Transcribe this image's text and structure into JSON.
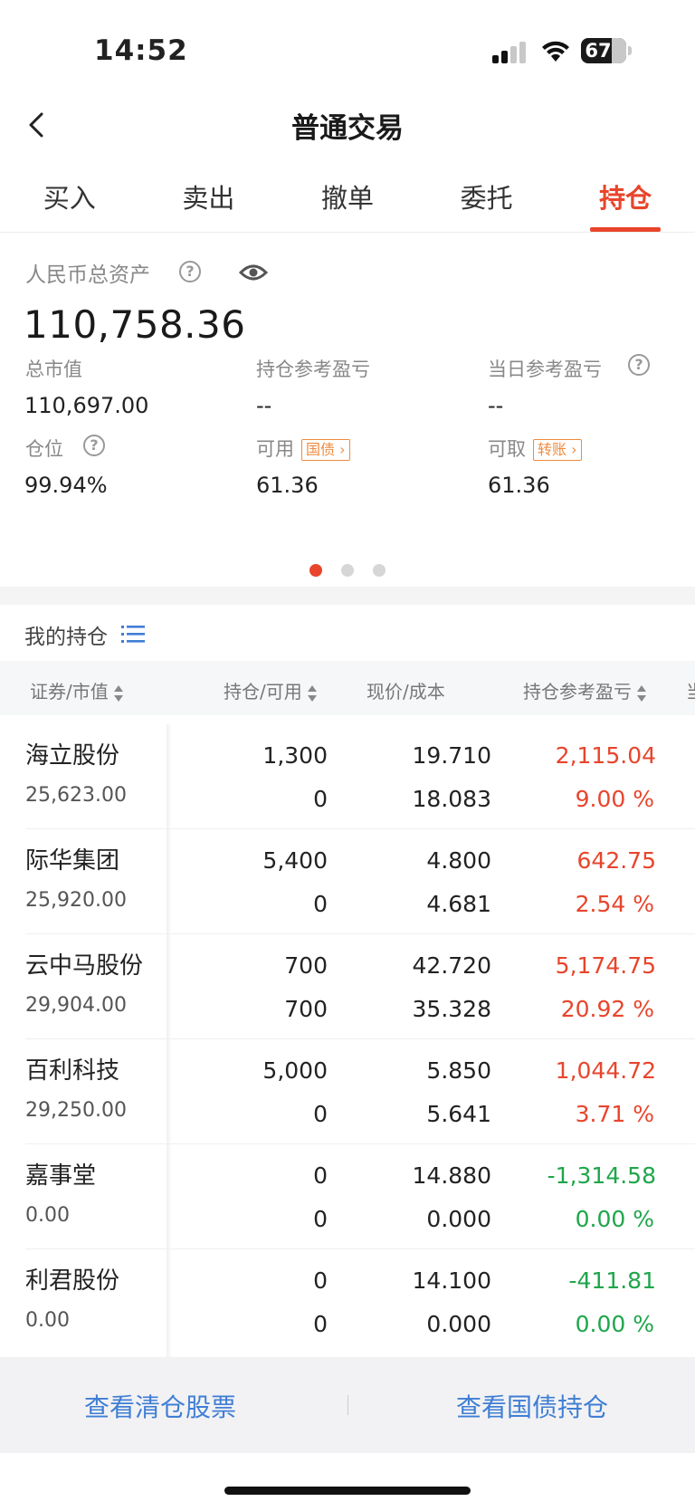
{
  "status_bar": {
    "time": "14:52",
    "battery": "67"
  },
  "nav": {
    "title": "普通交易"
  },
  "tabs": [
    {
      "label": "买入",
      "active": false
    },
    {
      "label": "卖出",
      "active": false
    },
    {
      "label": "撤单",
      "active": false
    },
    {
      "label": "委托",
      "active": false
    },
    {
      "label": "持仓",
      "active": true
    }
  ],
  "assets": {
    "label": "人民币总资产",
    "total": "110,758.36",
    "market_value_label": "总市值",
    "market_value": "110,697.00",
    "position_pnl_label": "持仓参考盈亏",
    "position_pnl": "--",
    "daily_pnl_label": "当日参考盈亏",
    "daily_pnl": "--",
    "position_ratio_label": "仓位",
    "position_ratio": "99.94%",
    "available_label": "可用",
    "available_tag": "国债",
    "available": "61.36",
    "withdrawable_label": "可取",
    "withdrawable_tag": "转账",
    "withdrawable": "61.36"
  },
  "holdings": {
    "title": "我的持仓",
    "headers": {
      "security": "证券/市值",
      "position": "持仓/可用",
      "price": "现价/成本",
      "pnl": "持仓参考盈亏",
      "extra": "当"
    },
    "rows": [
      {
        "name": "海立股份",
        "market_value": "25,623.00",
        "position": "1,300",
        "available": "0",
        "price": "19.710",
        "cost": "18.083",
        "pnl": "2,115.04",
        "pnl_pct": "9.00 %",
        "trend": "up"
      },
      {
        "name": "际华集团",
        "market_value": "25,920.00",
        "position": "5,400",
        "available": "0",
        "price": "4.800",
        "cost": "4.681",
        "pnl": "642.75",
        "pnl_pct": "2.54 %",
        "trend": "up"
      },
      {
        "name": "云中马股份",
        "market_value": "29,904.00",
        "position": "700",
        "available": "700",
        "price": "42.720",
        "cost": "35.328",
        "pnl": "5,174.75",
        "pnl_pct": "20.92 %",
        "trend": "up"
      },
      {
        "name": "百利科技",
        "market_value": "29,250.00",
        "position": "5,000",
        "available": "0",
        "price": "5.850",
        "cost": "5.641",
        "pnl": "1,044.72",
        "pnl_pct": "3.71 %",
        "trend": "up"
      },
      {
        "name": "嘉事堂",
        "market_value": "0.00",
        "position": "0",
        "available": "0",
        "price": "14.880",
        "cost": "0.000",
        "pnl": "-1,314.58",
        "pnl_pct": "0.00 %",
        "trend": "down"
      },
      {
        "name": "利君股份",
        "market_value": "0.00",
        "position": "0",
        "available": "0",
        "price": "14.100",
        "cost": "0.000",
        "pnl": "-411.81",
        "pnl_pct": "0.00 %",
        "trend": "down"
      }
    ]
  },
  "footer": {
    "cleared_label": "查看清仓股票",
    "bonds_label": "查看国债持仓"
  },
  "colors": {
    "accent": "#e8452c",
    "gain": "#e8452c",
    "loss": "#1fa64b",
    "link": "#3f7ed4"
  }
}
